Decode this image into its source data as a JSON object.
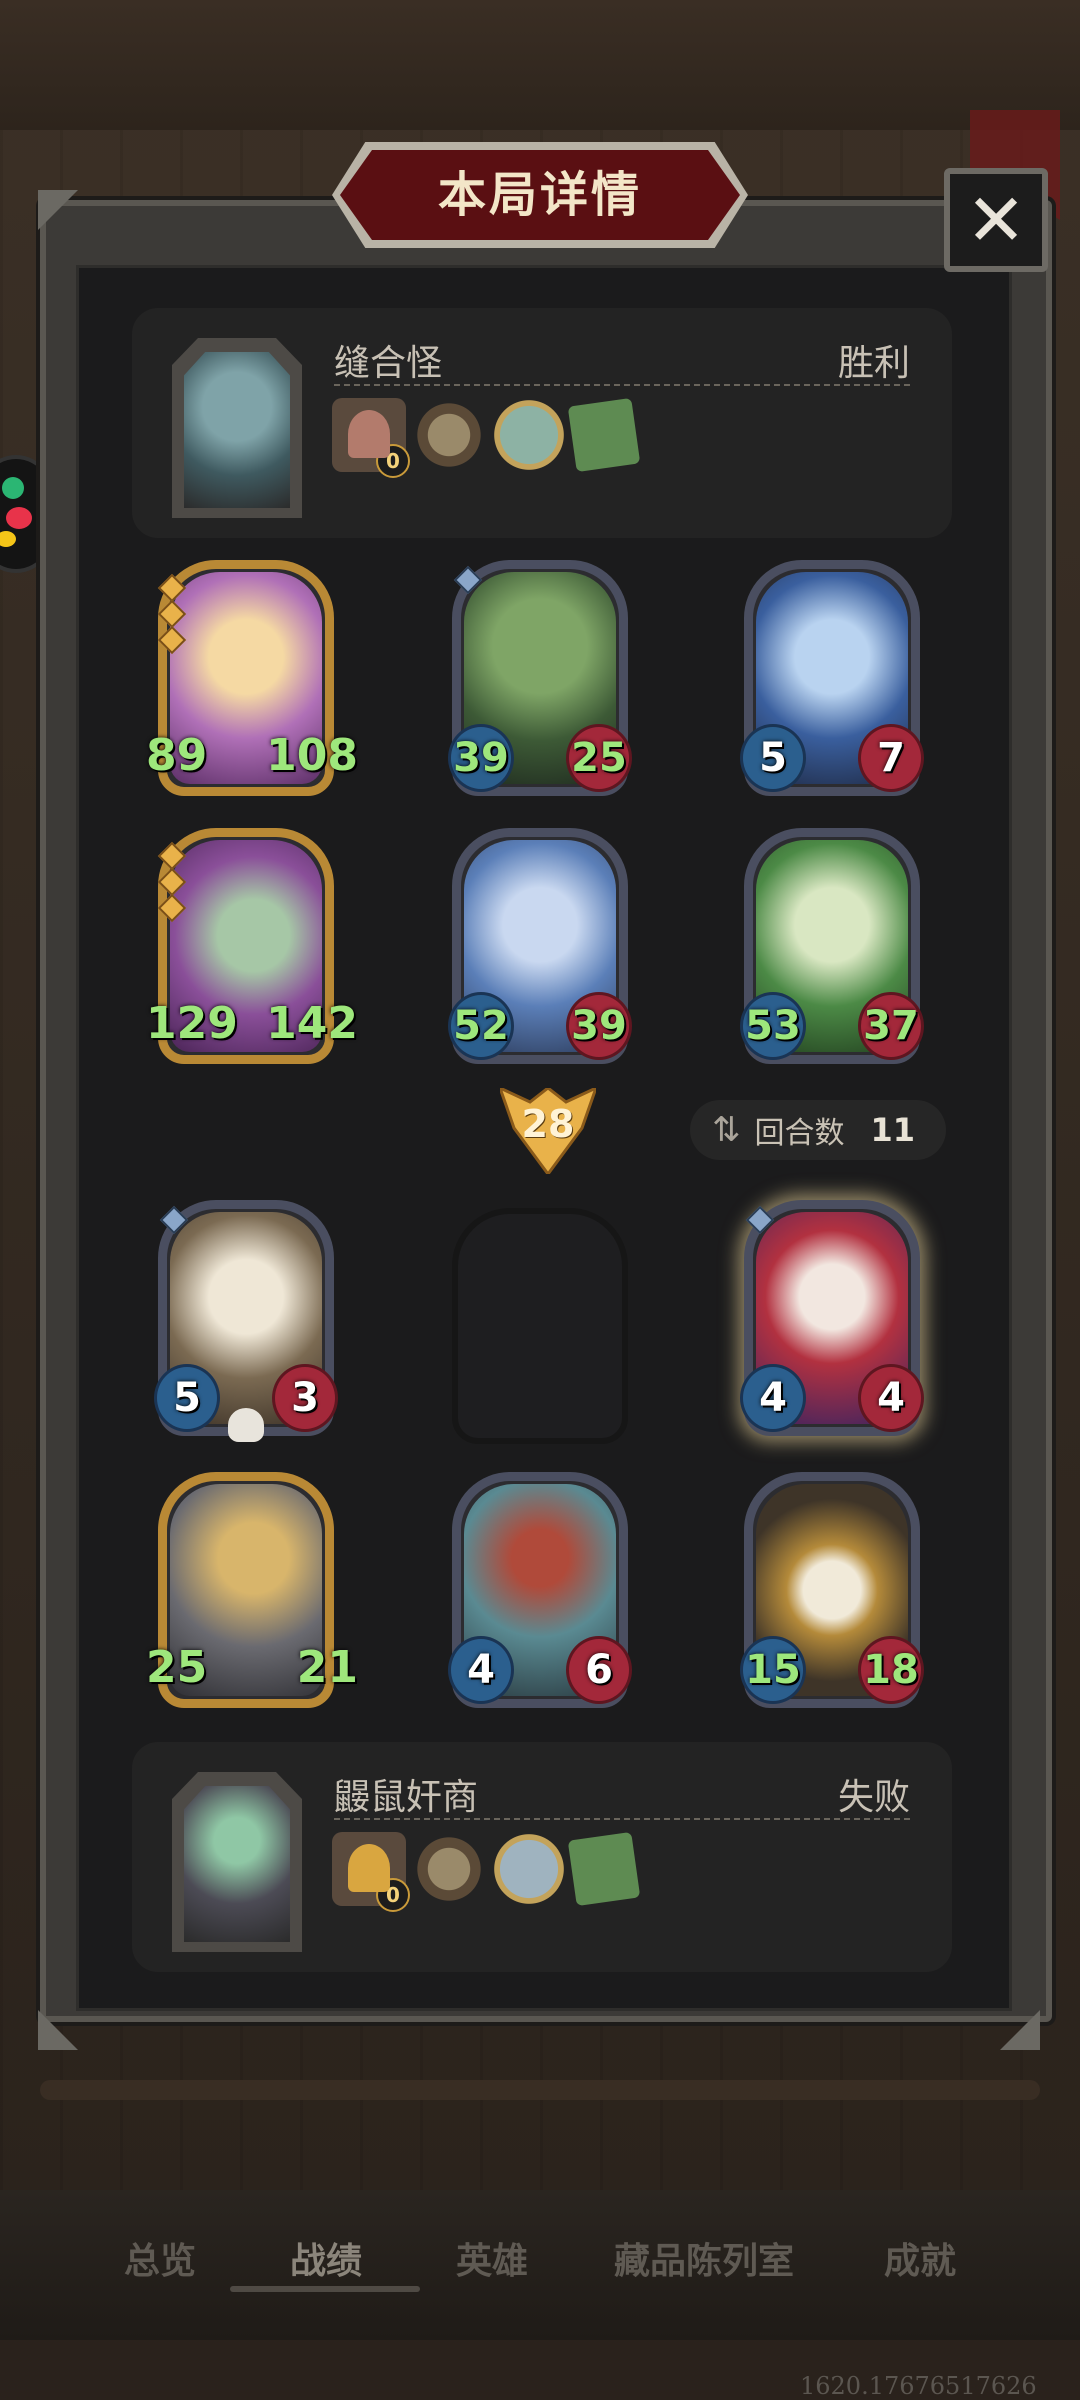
{
  "dialog": {
    "title": "本局详情",
    "close_label": "✕"
  },
  "top_player": {
    "name": "缝合怪",
    "result": "胜利",
    "gold_count": "0",
    "items": [
      "house-icon",
      "compass-icon",
      "sword-orb-icon",
      "green-book-icon"
    ]
  },
  "bottom_player": {
    "name": "鼹鼠奸商",
    "result": "失败",
    "gold_count": "0",
    "items": [
      "gold-house-icon",
      "compass-icon",
      "mirror-orb-icon",
      "green-book-icon"
    ]
  },
  "top_board": [
    {
      "attack": "89",
      "health": "108",
      "frame": "gold",
      "big": true
    },
    {
      "attack": "39",
      "health": "25",
      "frame": "blue",
      "big": false
    },
    {
      "attack": "5",
      "health": "7",
      "frame": "blue",
      "big": false
    },
    {
      "attack": "129",
      "health": "142",
      "frame": "gold",
      "big": true
    },
    {
      "attack": "52",
      "health": "39",
      "frame": "blue",
      "big": false
    },
    {
      "attack": "53",
      "health": "37",
      "frame": "blue",
      "big": false
    }
  ],
  "bottom_board": [
    {
      "attack": "5",
      "health": "3",
      "frame": "blue"
    },
    {
      "attack": "4",
      "health": "4",
      "frame": "blue"
    },
    {
      "attack": "25",
      "health": "21",
      "frame": "gold"
    },
    {
      "attack": "4",
      "health": "6",
      "frame": "blue"
    },
    {
      "attack": "15",
      "health": "18",
      "frame": "blue"
    }
  ],
  "damage": "28",
  "rounds": {
    "label": "回合数",
    "value": "11"
  },
  "tabs": [
    "总览",
    "战绩",
    "英雄",
    "藏品陈列室",
    "成就"
  ],
  "active_tab": "战绩",
  "footer_id": "1620.17676517626",
  "colors": {
    "panel": "#1b1b1c",
    "title_plate": "#5a0f12",
    "damage_badge": "#e9b24a",
    "stat_green": "#9ee77c"
  }
}
